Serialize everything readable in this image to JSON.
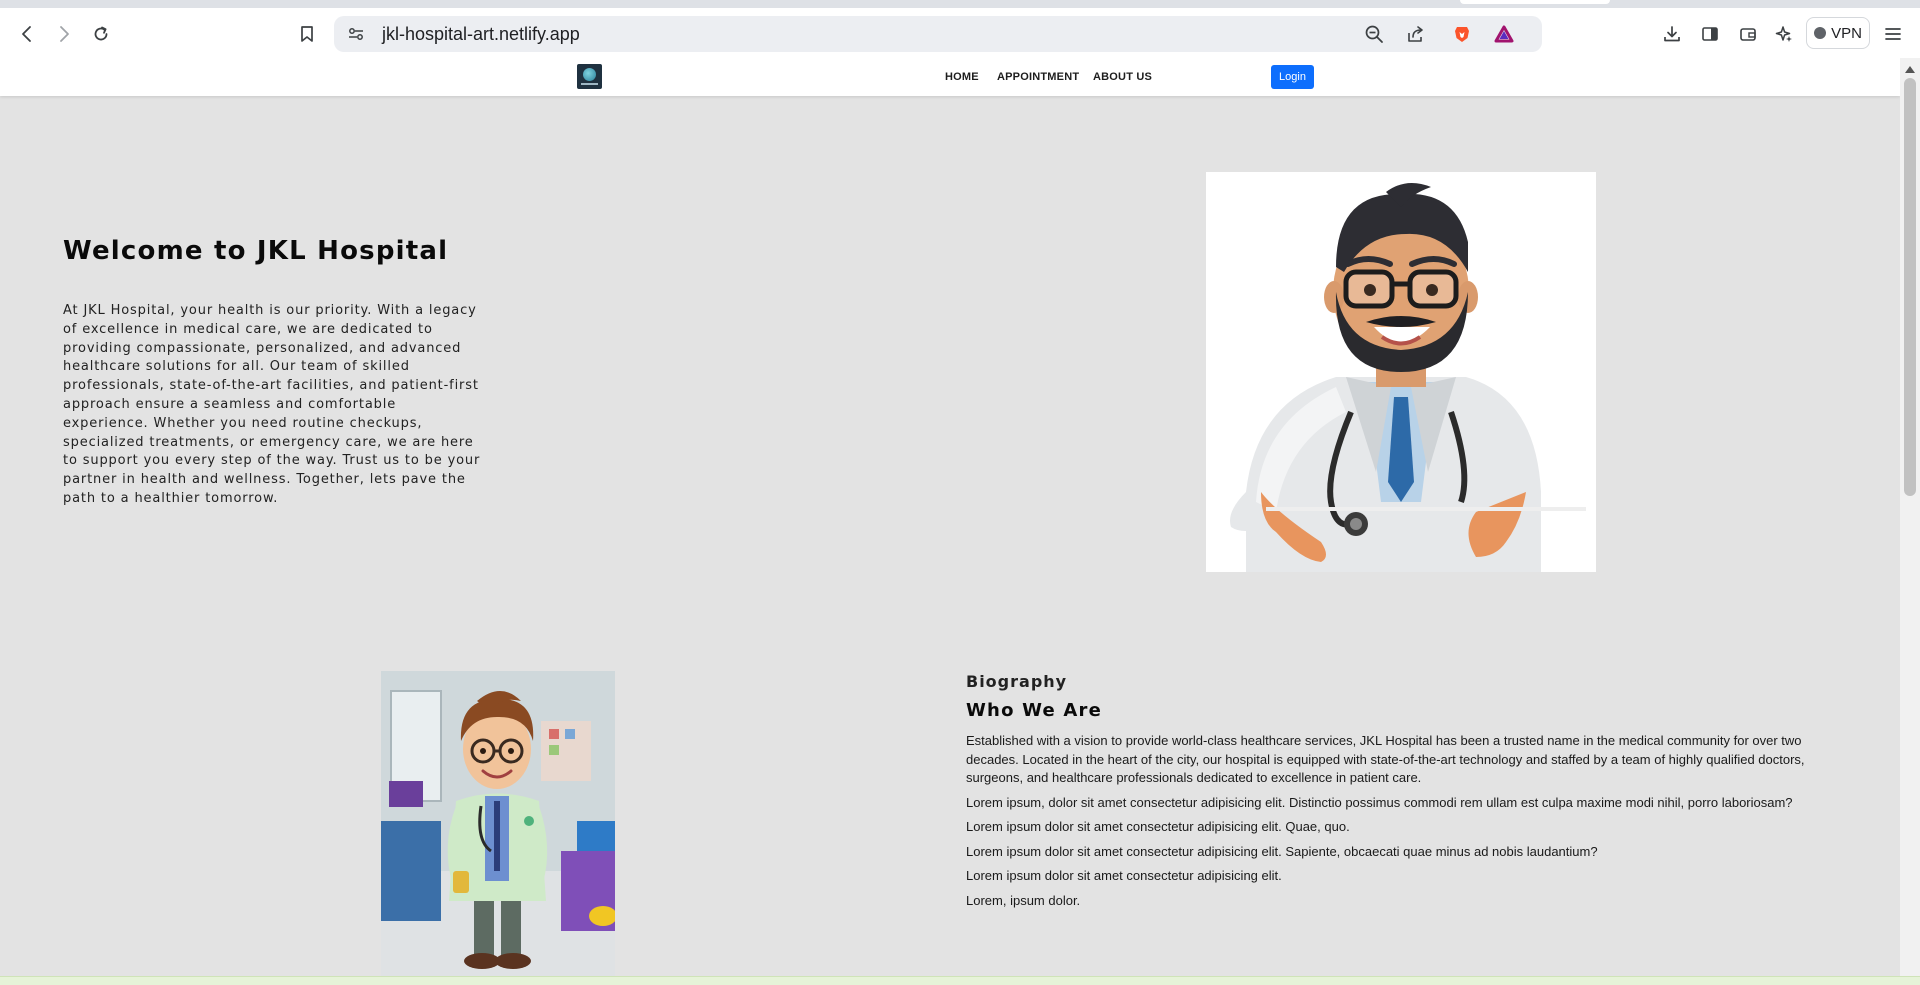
{
  "browser": {
    "url": "jkl-hospital-art.netlify.app",
    "vpn_label": "VPN",
    "icons": {
      "back": "back-arrow-icon",
      "forward": "forward-arrow-icon",
      "reload": "reload-icon",
      "bookmark": "bookmark-icon",
      "site_settings": "site-settings-icon",
      "zoom": "zoom-out-icon",
      "share": "share-icon",
      "brave_shields": "brave-lion-icon",
      "brave_rewards": "brave-rewards-triangle-icon",
      "downloads": "download-icon",
      "sidebar": "sidebar-icon",
      "wallet": "wallet-icon",
      "leo": "leo-ai-icon",
      "menu": "hamburger-menu-icon"
    }
  },
  "site": {
    "nav": {
      "links": [
        "HOME",
        "APPOINTMENT",
        "ABOUT US"
      ],
      "login_label": "Login"
    },
    "hero": {
      "title": "Welcome to JKL Hospital",
      "text": "At JKL Hospital, your health is our priority. With a legacy of excellence in medical care, we are dedicated to providing compassionate, personalized, and advanced healthcare solutions for all. Our team of skilled professionals, state-of-the-art facilities, and patient-first approach ensure a seamless and comfortable experience. Whether you need routine checkups, specialized treatments, or emergency care, we are here to support you every step of the way. Trust us to be your partner in health and wellness. Together, lets pave the path to a healthier tomorrow."
    },
    "biography": {
      "eyebrow": "Biography",
      "heading": "Who We Are",
      "paragraphs": [
        "Established with a vision to provide world-class healthcare services, JKL Hospital has been a trusted name in the medical community for over two decades. Located in the heart of the city, our hospital is equipped with state-of-the-art technology and staffed by a team of highly qualified doctors, surgeons, and healthcare professionals dedicated to excellence in patient care.",
        "Lorem ipsum, dolor sit amet consectetur adipisicing elit. Distinctio possimus commodi rem ullam est culpa maxime modi nihil, porro laboriosam?",
        "Lorem ipsum dolor sit amet consectetur adipisicing elit. Quae, quo.",
        "Lorem ipsum dolor sit amet consectetur adipisicing elit. Sapiente, obcaecati quae minus ad nobis laudantium?",
        "Lorem ipsum dolor sit amet consectetur adipisicing elit.",
        "Lorem, ipsum dolor."
      ]
    }
  },
  "colors": {
    "page_background": "#e3e3e3",
    "login_button": "#0d6efd",
    "heading_text": "#0a0a0a"
  }
}
